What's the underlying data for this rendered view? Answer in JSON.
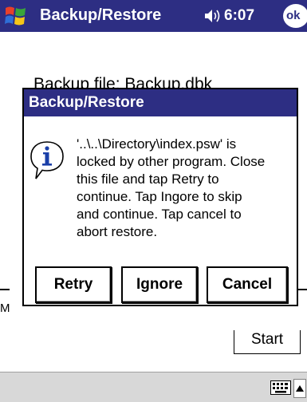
{
  "titlebar": {
    "title": "Backup/Restore",
    "time": "6:07",
    "ok_label": "ok",
    "start_icon": "windows-flag-icon",
    "volume_icon": "speaker-icon"
  },
  "background": {
    "file_label": "Backup file: Backup.dbk",
    "partial_text": "M",
    "start_button": "Start"
  },
  "dialog": {
    "title": "Backup/Restore",
    "icon": "info-icon",
    "message_lines": [
      "'..\\..\\Directory\\index.psw' is",
      "locked by other program. Close",
      "this file and tap Retry to",
      "continue. Tap Ingore to skip",
      "and continue. Tap cancel to",
      "abort restore."
    ],
    "buttons": {
      "retry": "Retry",
      "ignore": "Ignore",
      "cancel": "Cancel"
    }
  },
  "command_bar": {
    "keyboard_icon": "keyboard-icon",
    "sip_icon": "up-arrow-icon"
  },
  "colors": {
    "titlebar": "#2d2e83",
    "background": "#ffffff",
    "command_bar": "#d8d8d8"
  }
}
